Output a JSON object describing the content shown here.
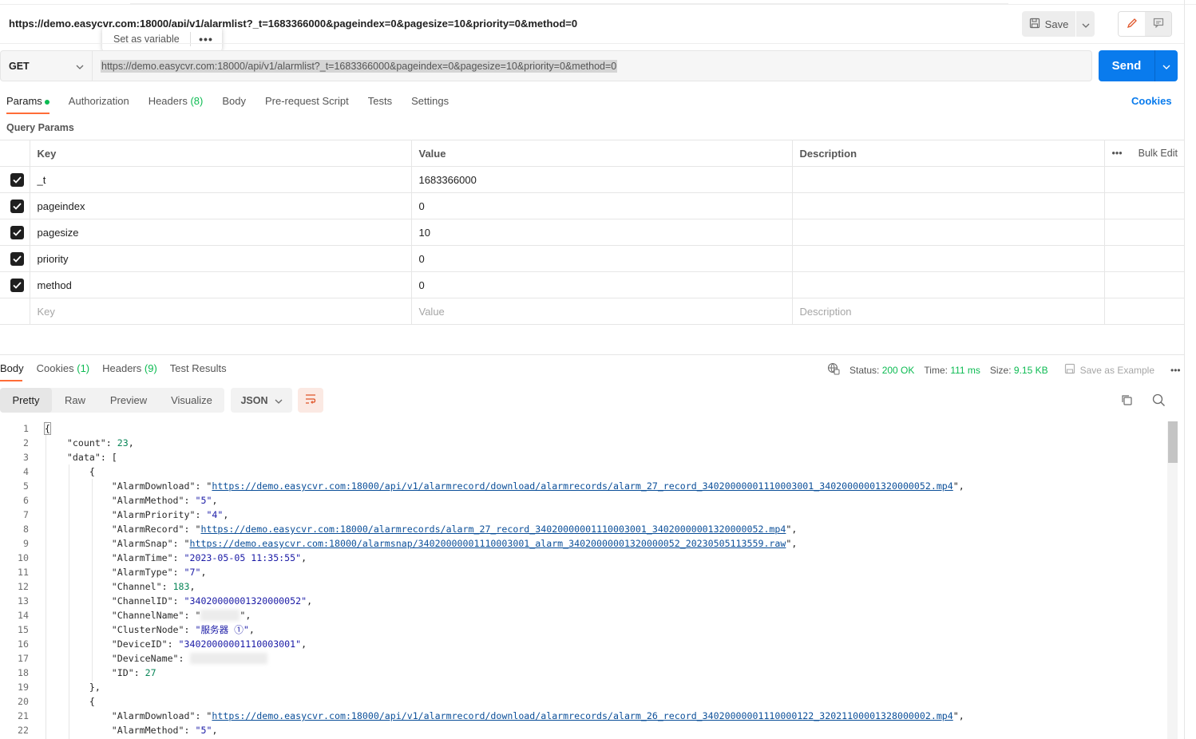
{
  "header": {
    "request_title": "https://demo.easycvr.com:18000/api/v1/alarmlist?_t=1683366000&pageindex=0&pagesize=10&priority=0&method=0",
    "popup_set_variable": "Set as variable",
    "popup_more": "•••",
    "save_label": "Save"
  },
  "request": {
    "method": "GET",
    "url": "https://demo.easycvr.com:18000/api/v1/alarmlist?_t=1683366000&pageindex=0&pagesize=10&priority=0&method=0",
    "send_label": "Send"
  },
  "req_tabs": {
    "params": "Params",
    "authorization": "Authorization",
    "headers": "Headers",
    "headers_count": "(8)",
    "body": "Body",
    "prerequest": "Pre-request Script",
    "tests": "Tests",
    "settings": "Settings",
    "cookies": "Cookies"
  },
  "query_params": {
    "label": "Query Params",
    "col_key": "Key",
    "col_value": "Value",
    "col_description": "Description",
    "more": "•••",
    "bulk_edit": "Bulk Edit",
    "rows": [
      {
        "key": "_t",
        "value": "1683366000"
      },
      {
        "key": "pageindex",
        "value": "0"
      },
      {
        "key": "pagesize",
        "value": "10"
      },
      {
        "key": "priority",
        "value": "0"
      },
      {
        "key": "method",
        "value": "0"
      }
    ],
    "placeholder_key": "Key",
    "placeholder_value": "Value",
    "placeholder_description": "Description"
  },
  "response": {
    "tabs": {
      "body": "Body",
      "cookies": "Cookies",
      "cookies_count": "(1)",
      "headers": "Headers",
      "headers_count": "(9)",
      "test_results": "Test Results"
    },
    "status_label": "Status:",
    "status_value": "200 OK",
    "time_label": "Time:",
    "time_value": "111 ms",
    "size_label": "Size:",
    "size_value": "9.15 KB",
    "save_example": "Save as Example",
    "more": "•••",
    "view_tabs": [
      "Pretty",
      "Raw",
      "Preview",
      "Visualize"
    ],
    "format": "JSON"
  },
  "code": {
    "l1": "{",
    "l2_key": "\"count\"",
    "l2_val": "23",
    "l3_key": "\"data\"",
    "l3_rest": ": [",
    "l4": "{",
    "l5_key": "\"AlarmDownload\"",
    "l5_val": "https://demo.easycvr.com:18000/api/v1/alarmrecord/download/alarmrecords/alarm_27_record_34020000001110003001_34020000001320000052.mp4",
    "l6_key": "\"AlarmMethod\"",
    "l6_val": "\"5\"",
    "l7_key": "\"AlarmPriority\"",
    "l7_val": "\"4\"",
    "l8_key": "\"AlarmRecord\"",
    "l8_val": "https://demo.easycvr.com:18000/alarmrecords/alarm_27_record_34020000001110003001_34020000001320000052.mp4",
    "l9_key": "\"AlarmSnap\"",
    "l9_val": "https://demo.easycvr.com:18000/alarmsnap/34020000001110003001_alarm_34020000001320000052_20230505113559.raw",
    "l10_key": "\"AlarmTime\"",
    "l10_val": "\"2023-05-05 11:35:55\"",
    "l11_key": "\"AlarmType\"",
    "l11_val": "\"7\"",
    "l12_key": "\"Channel\"",
    "l12_val": "183",
    "l13_key": "\"ChannelID\"",
    "l13_val": "\"34020000001320000052\"",
    "l14_key": "\"ChannelName\"",
    "l15_key": "\"ClusterNode\"",
    "l15_val": "\"服务器 ①\"",
    "l16_key": "\"DeviceID\"",
    "l16_val": "\"34020000001110003001\"",
    "l17_key": "\"DeviceName\"",
    "l18_key": "\"ID\"",
    "l18_val": "27",
    "l19": "},",
    "l20": "{",
    "l21_key": "\"AlarmDownload\"",
    "l21_val": "https://demo.easycvr.com:18000/api/v1/alarmrecord/download/alarmrecords/alarm_26_record_34020000001110000122_32021100001328000002.mp4",
    "l22_key": "\"AlarmMethod\"",
    "l22_val": "\"5\""
  },
  "line_numbers": [
    "1",
    "2",
    "3",
    "4",
    "5",
    "6",
    "7",
    "8",
    "9",
    "10",
    "11",
    "12",
    "13",
    "14",
    "15",
    "16",
    "17",
    "18",
    "19",
    "20",
    "21",
    "22"
  ],
  "colors": {
    "accent": "#ff6c37",
    "send": "#097bed",
    "status_ok": "#0cbb52"
  }
}
